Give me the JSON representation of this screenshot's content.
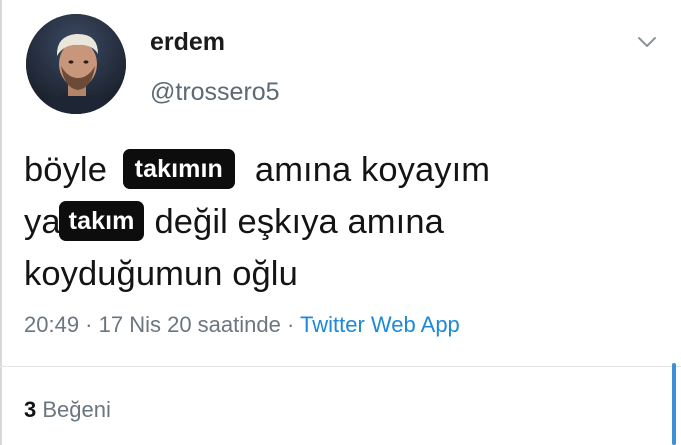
{
  "user": {
    "display_name": "erdem",
    "handle": "@trossero5"
  },
  "tweet": {
    "line1_start": "böyle",
    "censor1": "takımın",
    "line1_end": "amına koyayım",
    "line2_start": "ya",
    "censor2": "takım",
    "line2_end": "değil eşkıya amına",
    "line3": "koyduğumun oğlu"
  },
  "meta": {
    "time": "20:49",
    "separator1": " · ",
    "date": "17 Nis 20 saatinde",
    "separator2": " · ",
    "source": "Twitter Web App"
  },
  "stats": {
    "likes_count": "3",
    "likes_label": "Beğeni"
  },
  "icons": {
    "menu": "chevron-down-icon",
    "avatar": "avatar"
  },
  "colors": {
    "link": "#1c8ad8",
    "secondary_text": "#6b7680",
    "censor_bg": "#0d0d0d"
  }
}
